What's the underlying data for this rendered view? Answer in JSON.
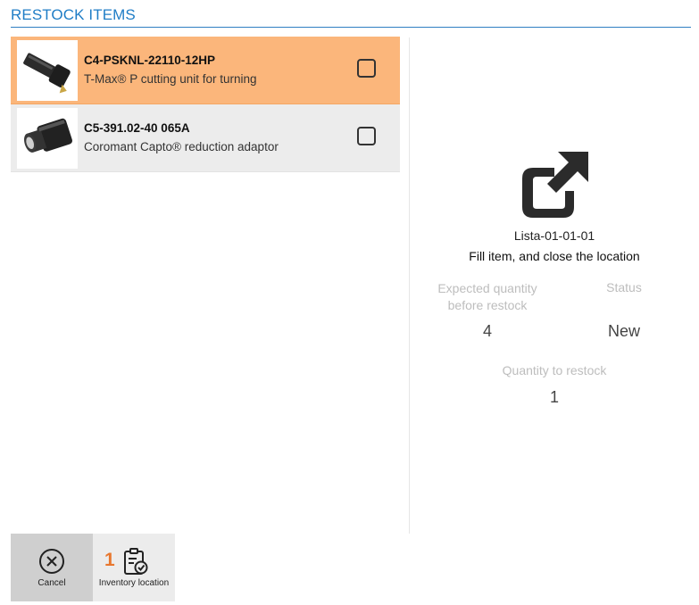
{
  "header": {
    "title": "RESTOCK ITEMS"
  },
  "items": [
    {
      "code": "C4-PSKNL-22110-12HP",
      "description": "T-Max® P cutting unit for turning",
      "selected": true,
      "checked": false
    },
    {
      "code": "C5-391.02-40 065A",
      "description": "Coromant Capto® reduction adaptor",
      "selected": false,
      "checked": false
    }
  ],
  "detail": {
    "icon": "external-link-icon",
    "location_name": "Lista-01-01-01",
    "instruction": "Fill item, and close the location",
    "expected_label": "Expected quantity before restock",
    "expected_value": "4",
    "status_label": "Status",
    "status_value": "New",
    "restock_label": "Quantity to restock",
    "restock_value": "1"
  },
  "footer": {
    "cancel_label": "Cancel",
    "location_count": "1",
    "location_label": "Inventory location"
  },
  "colors": {
    "accent": "#1f7dc6",
    "selected_row": "#fbb67b",
    "row": "#ececec",
    "badge": "#e8772e"
  }
}
